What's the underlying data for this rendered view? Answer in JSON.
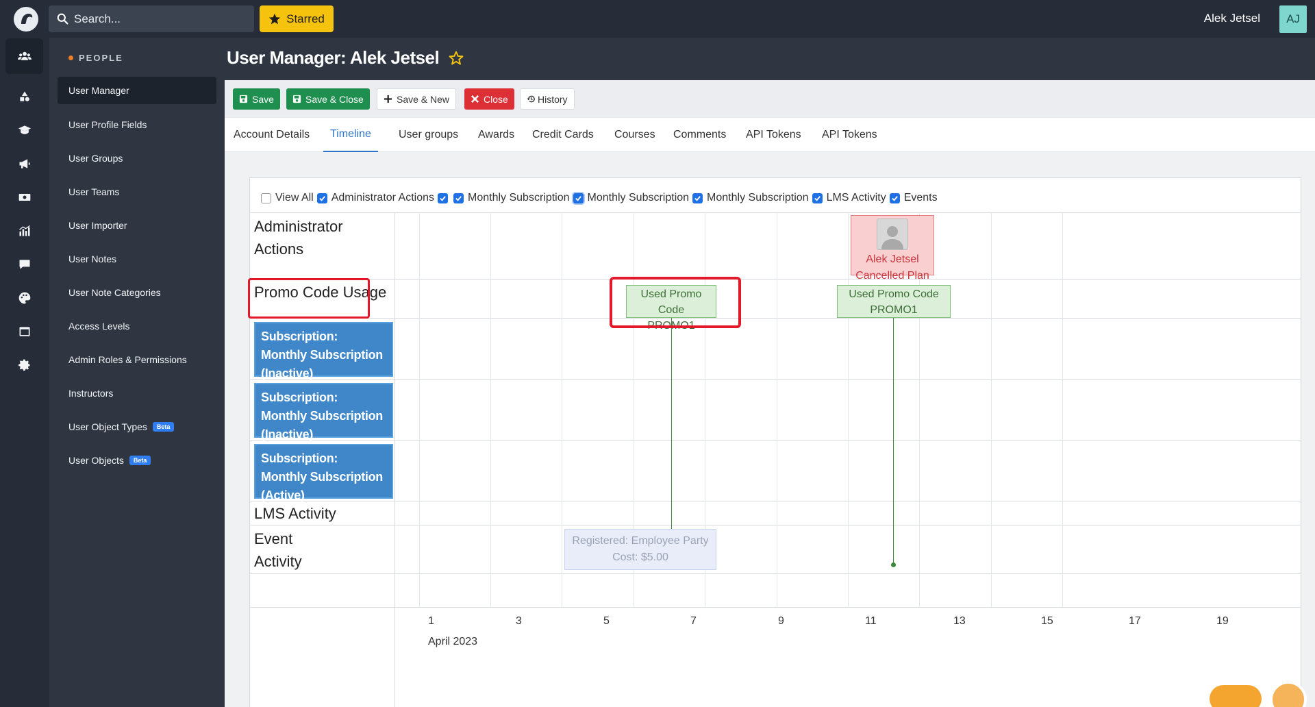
{
  "topbar": {
    "search_placeholder": "Search...",
    "starred_label": "Starred",
    "user_name": "Alek Jetsel",
    "avatar_initials": "AJ"
  },
  "sidebar": {
    "section_title": "PEOPLE",
    "items": [
      {
        "label": "User Manager",
        "active": true
      },
      {
        "label": "User Profile Fields"
      },
      {
        "label": "User Groups"
      },
      {
        "label": "User Teams"
      },
      {
        "label": "User Importer"
      },
      {
        "label": "User Notes"
      },
      {
        "label": "User Note Categories"
      },
      {
        "label": "Access Levels"
      },
      {
        "label": "Admin Roles & Permissions"
      },
      {
        "label": "Instructors"
      },
      {
        "label": "User Object Types",
        "badge": "Beta"
      },
      {
        "label": "User Objects",
        "badge": "Beta"
      }
    ]
  },
  "rail": {
    "icons": [
      "users-icon",
      "shapes-icon",
      "graduation-cap-icon",
      "megaphone-icon",
      "money-icon",
      "chart-icon",
      "chat-icon",
      "palette-icon",
      "window-icon",
      "gear-icon"
    ]
  },
  "header": {
    "title": "User Manager: Alek Jetsel"
  },
  "toolbar": {
    "save": "Save",
    "save_close": "Save & Close",
    "save_new": "Save & New",
    "close": "Close",
    "history": "History"
  },
  "tabs": [
    {
      "label": "Account Details"
    },
    {
      "label": "Timeline",
      "active": true
    },
    {
      "label": "User groups"
    },
    {
      "label": "Awards"
    },
    {
      "label": "Credit Cards"
    },
    {
      "label": "Courses"
    },
    {
      "label": "Comments"
    },
    {
      "label": "API Tokens"
    },
    {
      "label": "API Tokens"
    }
  ],
  "timeline": {
    "filters": [
      {
        "label": "View All",
        "checked": false
      },
      {
        "label": "Administrator Actions",
        "checked": true
      },
      {
        "label": "Monthly Subscription",
        "checked": true
      },
      {
        "label": "Monthly Subscription",
        "checked": true
      },
      {
        "label": "Monthly Subscription",
        "checked": true
      },
      {
        "label": "LMS Activity",
        "checked": true
      },
      {
        "label": "Events",
        "checked": true
      }
    ],
    "rows": {
      "admin": "Administrator Actions",
      "promo": "Promo Code Usage",
      "sub1": "Subscription: Monthly Subscription (Inactive)",
      "sub2": "Subscription: Monthly Subscription (Inactive)",
      "sub3": "Subscription: Monthly Subscription (Active)",
      "lms": "LMS Activity",
      "event": "Event Activity"
    },
    "events": {
      "admin_event_line1": "Alek Jetsel",
      "admin_event_line2": "Cancelled Plan",
      "promo1_line1": "Used Promo Code",
      "promo1_line2": "PROMO1",
      "promo2_line1": "Used Promo Code",
      "promo2_line2": "PROMO1",
      "party_line1": "Registered: Employee Party",
      "party_line2": "Cost: $5.00"
    },
    "axis": {
      "ticks": [
        "1",
        "3",
        "5",
        "7",
        "9",
        "11",
        "13",
        "15",
        "17",
        "19"
      ],
      "month": "April 2023"
    }
  }
}
